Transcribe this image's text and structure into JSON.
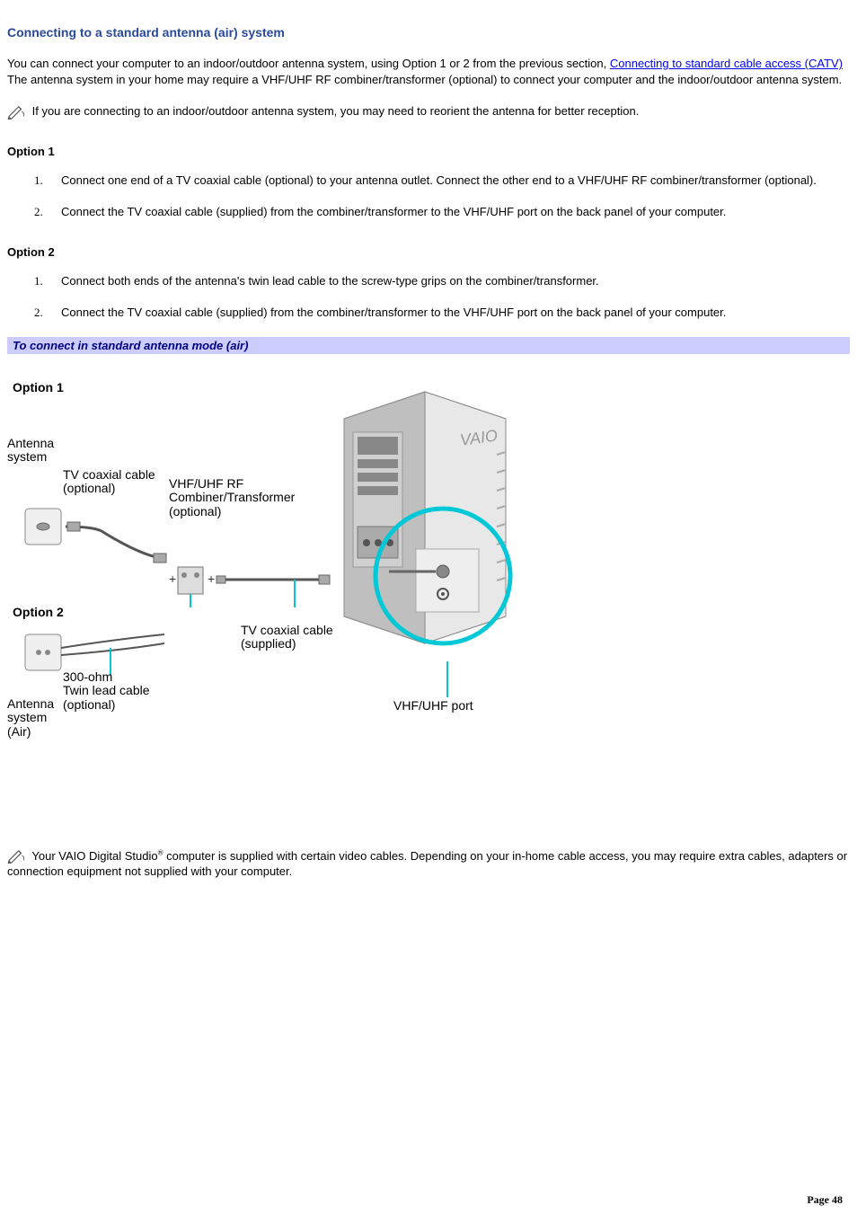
{
  "title": "Connecting to a standard antenna (air) system",
  "intro_pre": "You can connect your computer to an indoor/outdoor antenna system, using Option 1 or 2 from the previous section, ",
  "intro_link": "Connecting to standard cable access (CATV)",
  "intro_post": " The antenna system in your home may require a VHF/UHF RF combiner/transformer (optional) to connect your computer and the indoor/outdoor antenna system.",
  "note1": " If you are connecting to an indoor/outdoor antenna system, you may need to reorient the antenna for better reception.",
  "option1": {
    "label": "Option 1",
    "steps": [
      "Connect one end of a TV coaxial cable (optional) to your antenna outlet. Connect the other end to a VHF/UHF RF combiner/transformer (optional).",
      "Connect the TV coaxial cable (supplied) from the combiner/transformer to the VHF/UHF port on the back panel of your computer."
    ]
  },
  "option2": {
    "label": "Option 2",
    "steps": [
      "Connect both ends of the antenna's twin lead cable to the screw-type grips on the combiner/transformer.",
      "Connect the TV coaxial cable (supplied) from the combiner/transformer to the VHF/UHF port on the back panel of your computer."
    ]
  },
  "figure": {
    "caption": "To connect in standard antenna mode (air)",
    "labels": {
      "opt1": "Option 1",
      "antenna_system": "Antenna\nsystem",
      "coax_optional": "TV coaxial cable\n(optional)",
      "combiner": "VHF/UHF RF\nCombiner/Transformer\n(optional)",
      "opt2": "Option 2",
      "twin_lead": "300-ohm\nTwin lead cable\n(optional)",
      "antenna_air": "Antenna\nsystem\n(Air)",
      "coax_supplied": "TV coaxial cable\n(supplied)",
      "port": "VHF/UHF port",
      "vaio": "VAIO"
    }
  },
  "note2_pre": " Your VAIO Digital Studio",
  "note2_reg": "®",
  "note2_post": " computer is supplied with certain video cables. Depending on your in-home cable access, you may require extra cables, adapters or connection equipment not supplied with your computer.",
  "page_label": "Page ",
  "page_num": "48"
}
